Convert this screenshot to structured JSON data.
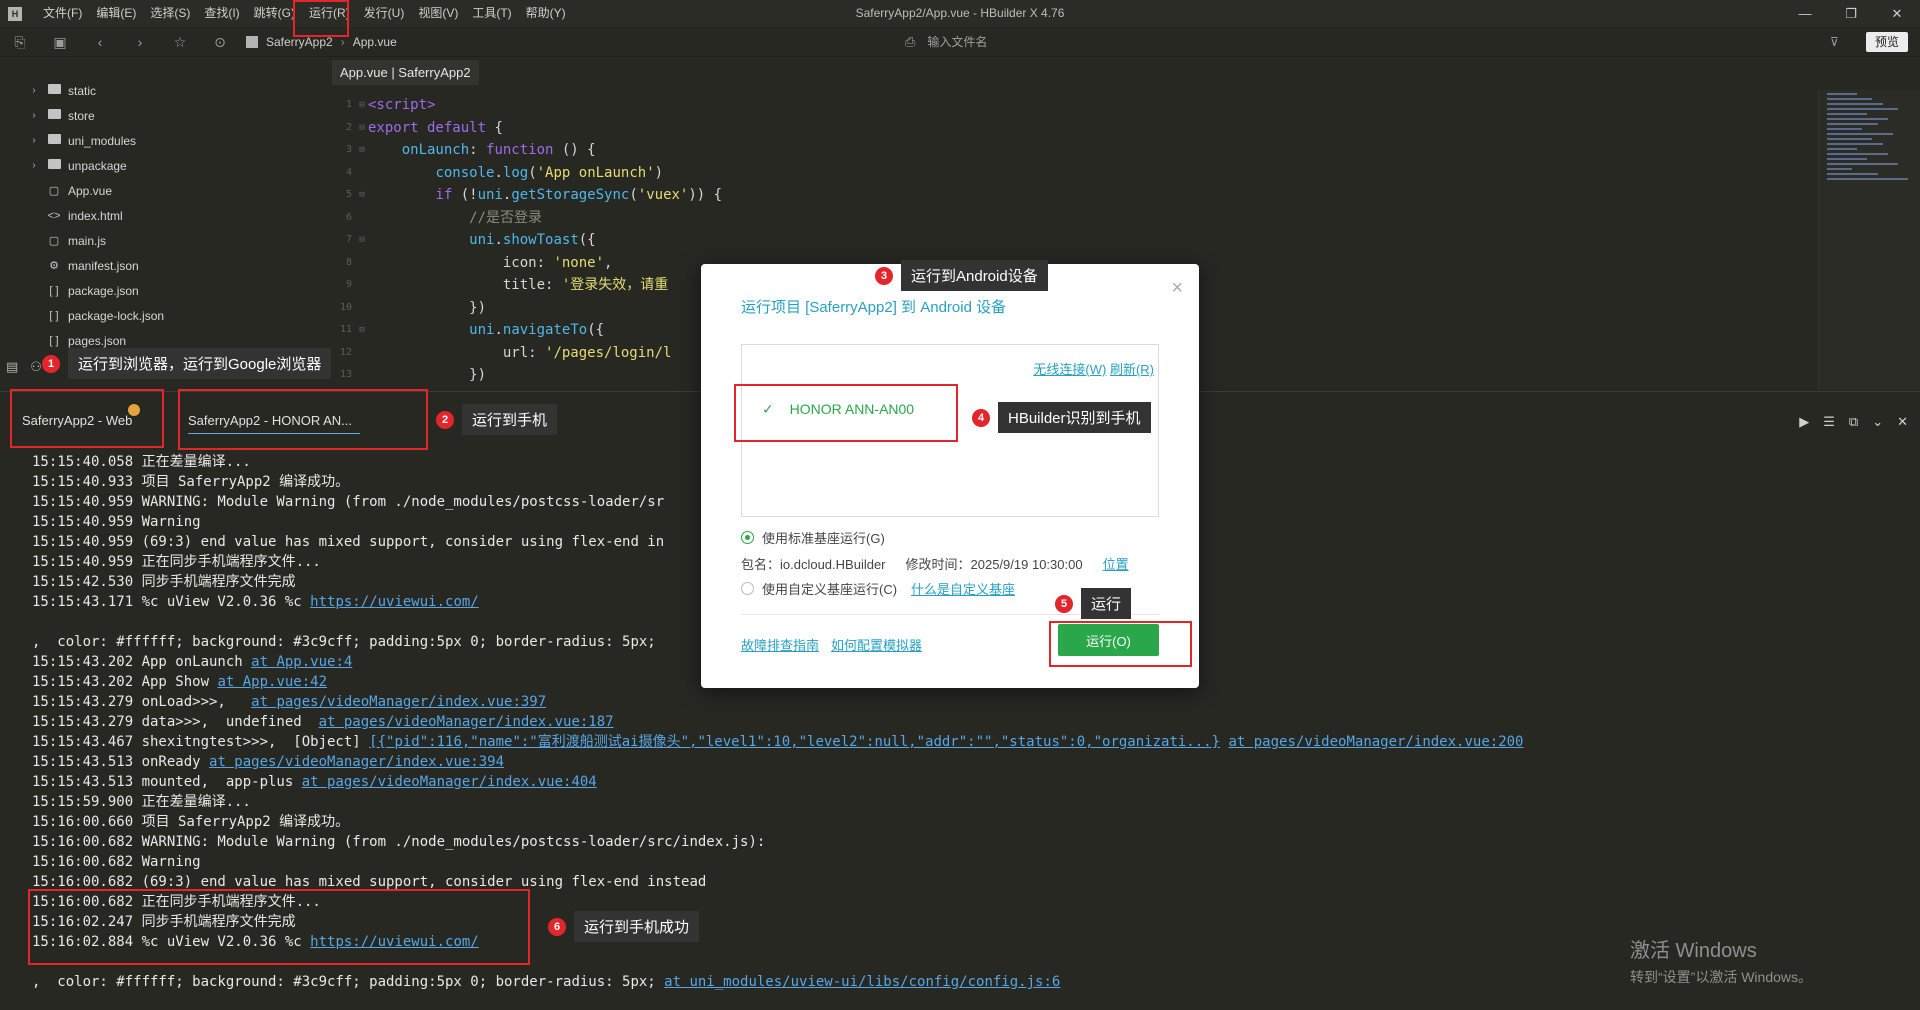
{
  "window": {
    "title": "SaferryApp2/App.vue - HBuilder X 4.76",
    "logo": "H",
    "minimize": "—",
    "maximize": "❐",
    "close": "✕"
  },
  "menu": [
    "文件(F)",
    "编辑(E)",
    "选择(S)",
    "查找(I)",
    "跳转(G)",
    "运行(R)",
    "发行(U)",
    "视图(V)",
    "工具(T)",
    "帮助(Y)"
  ],
  "toolbar": {
    "breadcrumb": [
      "SaferryApp2",
      "App.vue"
    ],
    "search_placeholder": "输入文件名",
    "preview_label": "预览"
  },
  "sidebar": {
    "items": [
      {
        "label": "static",
        "icon": "folder-icon",
        "expandable": true
      },
      {
        "label": "store",
        "icon": "folder-icon",
        "expandable": true
      },
      {
        "label": "uni_modules",
        "icon": "folder-icon",
        "expandable": true
      },
      {
        "label": "unpackage",
        "icon": "folder-icon",
        "expandable": true
      },
      {
        "label": "App.vue",
        "icon": "vue-file-icon",
        "expandable": false
      },
      {
        "label": "index.html",
        "icon": "html-file-icon",
        "expandable": false
      },
      {
        "label": "main.js",
        "icon": "js-file-icon",
        "expandable": false
      },
      {
        "label": "manifest.json",
        "icon": "manifest-file-icon",
        "expandable": false
      },
      {
        "label": "package.json",
        "icon": "json-file-icon",
        "expandable": false
      },
      {
        "label": "package-lock.json",
        "icon": "json-file-icon",
        "expandable": false
      },
      {
        "label": "pages.json",
        "icon": "json-file-icon",
        "expandable": false
      }
    ]
  },
  "editor": {
    "tab_label": "App.vue | SaferryApp2"
  },
  "console": {
    "tabs": [
      "SaferryApp2 - Web",
      "SaferryApp2 - HONOR AN..."
    ],
    "lines": [
      "15:15:40.058 正在差量编译...",
      "15:15:40.933 项目 SaferryApp2 编译成功。",
      "15:15:40.959 WARNING: Module Warning (from ./node_modules/postcss-loader/sr",
      "15:15:40.959 Warning",
      "15:15:40.959 (69:3) end value has mixed support, consider using flex-end in",
      "15:15:40.959 正在同步手机端程序文件...",
      "15:15:42.530 同步手机端程序文件完成",
      "15:15:43.171 %c uView V2.0.36 %c ",
      "",
      ",  color: #ffffff; background: #3c9cff; padding:5px 0; border-radius: 5px;",
      "15:15:43.202 App onLaunch ",
      "15:15:43.202 App Show ",
      "15:15:43.279 onLoad>>>,   ",
      "15:15:43.279 data>>>,  undefined  ",
      "15:15:43.467 shexitngtest>>>,  [Object] ",
      "15:15:43.513 onReady ",
      "15:15:43.513 mounted,  app-plus ",
      "15:15:59.900 正在差量编译...",
      "15:16:00.660 项目 SaferryApp2 编译成功。",
      "15:16:00.682 WARNING: Module Warning (from ./node_modules/postcss-loader/src/index.js):",
      "15:16:00.682 Warning",
      "15:16:00.682 (69:3) end value has mixed support, consider using flex-end instead",
      "15:16:00.682 正在同步手机端程序文件...",
      "15:16:02.247 同步手机端程序文件完成",
      "15:16:02.884 %c uView V2.0.36 %c ",
      "",
      ",  color: #ffffff; background: #3c9cff; padding:5px 0; border-radius: 5px; "
    ],
    "links": {
      "uview1": "https://uviewui.com/",
      "app4": "at App.vue:4",
      "app42": "at App.vue:42",
      "vm397": "at pages/videoManager/index.vue:397",
      "vm187": "at pages/videoManager/index.vue:187",
      "obj": "[{\"pid\":116,\"name\":\"富利渡船测试ai摄像头\",\"level1\":10,\"level2\":null,\"addr\":\"\",\"status\":0,\"organizati...}",
      "vm200": "at pages/videoManager/index.vue:200",
      "vm394": "at pages/videoManager/index.vue:394",
      "vm404": "at pages/videoManager/index.vue:404",
      "uview2": "https://uviewui.com/",
      "config": "at uni_modules/uview-ui/libs/config/config.js:6"
    }
  },
  "dialog": {
    "title": "运行项目 [SaferryApp2] 到 Android 设备",
    "close": "×",
    "wireless_link": "无线连接(W)",
    "refresh_link": "刷新(R)",
    "device_check": "✓",
    "device_name": "HONOR ANN-AN00",
    "opt_standard": "使用标准基座运行(G)",
    "pkg_name": "包名：io.dcloud.HBuilder",
    "mod_time": "修改时间：2025/9/19 10:30:00",
    "location_link": "位置",
    "opt_custom": "使用自定义基座运行(C)",
    "what_custom_link": "什么是自定义基座",
    "troubleshoot_link": "故障排查指南",
    "emulator_link": "如何配置模拟器",
    "run_button": "运行(O)"
  },
  "annotations": [
    {
      "num": "1",
      "text": "运行到浏览器，运行到Google浏览器"
    },
    {
      "num": "2",
      "text": "运行到手机"
    },
    {
      "num": "3",
      "text": "运行到Android设备"
    },
    {
      "num": "4",
      "text": "HBuilder识别到手机"
    },
    {
      "num": "5",
      "text": "运行"
    },
    {
      "num": "6",
      "text": "运行到手机成功"
    }
  ],
  "watermark": {
    "line1": "激活 Windows",
    "line2": "转到“设置”以激活 Windows。"
  },
  "colors": {
    "accent_green": "#2aa74a",
    "link_blue": "#27a0c2",
    "annotation_red": "#e3262b",
    "editor_bg": "#272822"
  }
}
